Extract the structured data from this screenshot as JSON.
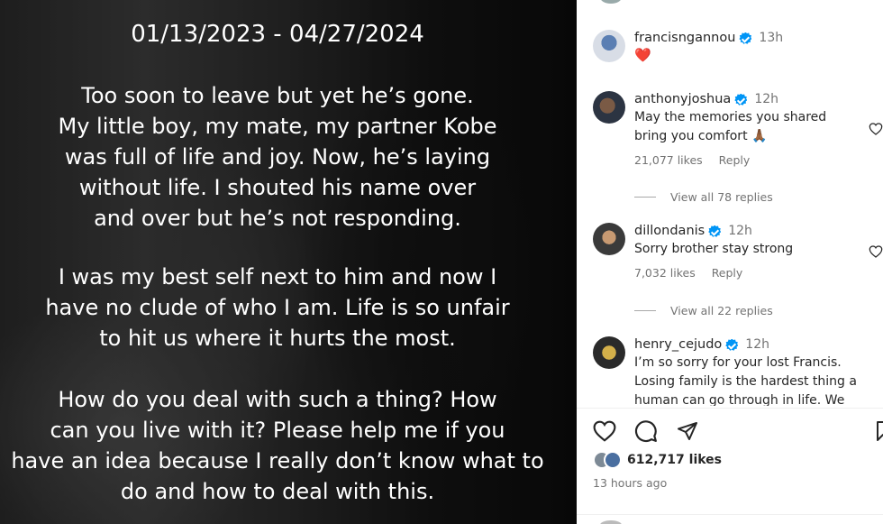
{
  "post": {
    "date_range": "01/13/2023 - 04/27/2024",
    "paragraph_1": "Too soon to leave but yet he’s gone.\nMy little boy, my mate, my partner Kobe\nwas full of life and joy. Now, he’s laying\nwithout life. I shouted his name over\nand over but he’s not responding.",
    "paragraph_2": "I was my best self next to him and now I\nhave no clude of who I am. Life is so unfair\nto hit us where it hurts the most.",
    "paragraph_3": "How do you deal with such a thing? How\ncan you live with it? Please help me if you\nhave an idea because I really don’t know what to\ndo and how to deal with this."
  },
  "comments": [
    {
      "username": "francisngannou",
      "time": "13h",
      "text": "❤️",
      "likes": "",
      "reply_label": "",
      "view_replies": ""
    },
    {
      "username": "anthonyjoshua",
      "time": "12h",
      "text": "May the memories you shared\nbring you comfort 🙏🏾",
      "likes": "21,077 likes",
      "reply_label": "Reply",
      "view_replies": "View all 78 replies"
    },
    {
      "username": "dillondanis",
      "time": "12h",
      "text": "Sorry brother stay strong",
      "likes": "7,032 likes",
      "reply_label": "Reply",
      "view_replies": "View all 22 replies"
    },
    {
      "username": "henry_cejudo",
      "time": "12h",
      "text": "I’m so sorry for your lost Francis.\nLosing family is the hardest thing a\nhuman can go through in life. We",
      "likes": "",
      "reply_label": "",
      "view_replies": ""
    }
  ],
  "footer": {
    "likes_count": "612,717 likes",
    "posted_time": "13 hours ago"
  },
  "icons": {
    "like": "heart-outline-icon",
    "comment": "comment-bubble-icon",
    "share": "paper-plane-icon",
    "save": "bookmark-icon",
    "comment_like": "heart-outline-icon"
  },
  "colors": {
    "verified": "#0095f6",
    "text": "#262626",
    "secondary": "#737373",
    "heart_emoji": "#e0245e"
  }
}
